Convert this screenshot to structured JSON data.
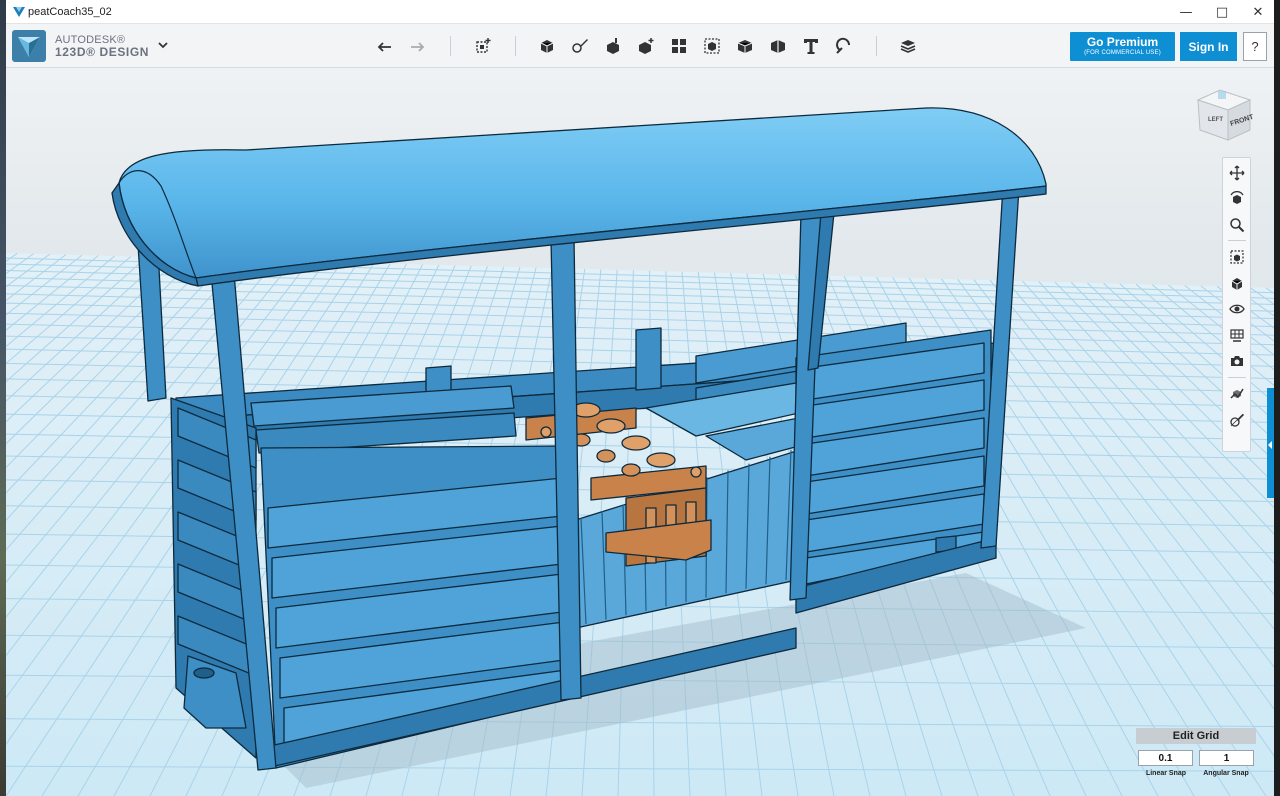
{
  "window": {
    "title": "peatCoach35_02"
  },
  "brand": {
    "line1": "AUTODESK®",
    "line2": "123D® DESIGN"
  },
  "toolbar": {
    "tools": [
      {
        "name": "undo-icon",
        "label": "Undo"
      },
      {
        "name": "redo-icon",
        "label": "Redo"
      },
      {
        "name": "transform-icon",
        "label": "Transform"
      },
      {
        "name": "primitives-icon",
        "label": "Primitives"
      },
      {
        "name": "sketch-icon",
        "label": "Sketch"
      },
      {
        "name": "construct-icon",
        "label": "Construct"
      },
      {
        "name": "modify-icon",
        "label": "Modify"
      },
      {
        "name": "pattern-icon",
        "label": "Pattern"
      },
      {
        "name": "grouping-icon",
        "label": "Grouping"
      },
      {
        "name": "combine-icon",
        "label": "Combine"
      },
      {
        "name": "measure-icon",
        "label": "Measure"
      },
      {
        "name": "text-icon",
        "label": "Text"
      },
      {
        "name": "snap-icon",
        "label": "Snap"
      },
      {
        "name": "material-icon",
        "label": "Material"
      }
    ]
  },
  "account": {
    "premium_label": "Go Premium",
    "premium_sub": "(FOR COMMERCIAL USE)",
    "signin_label": "Sign In",
    "help_label": "?"
  },
  "viewcube": {
    "front_label": "FRONT",
    "side_label": "LEFT"
  },
  "grid": {
    "edit_label": "Edit Grid",
    "linear_snap_value": "0.1",
    "angular_snap_value": "1",
    "linear_snap_label": "Linear Snap",
    "angular_snap_label": "Angular Snap"
  },
  "colors": {
    "accent": "#0e8fd4",
    "model_blue": "#3d8fc6",
    "model_blue_light": "#5db3e6",
    "brass": "#c9824a",
    "grid_line": "#a9d3ea"
  }
}
